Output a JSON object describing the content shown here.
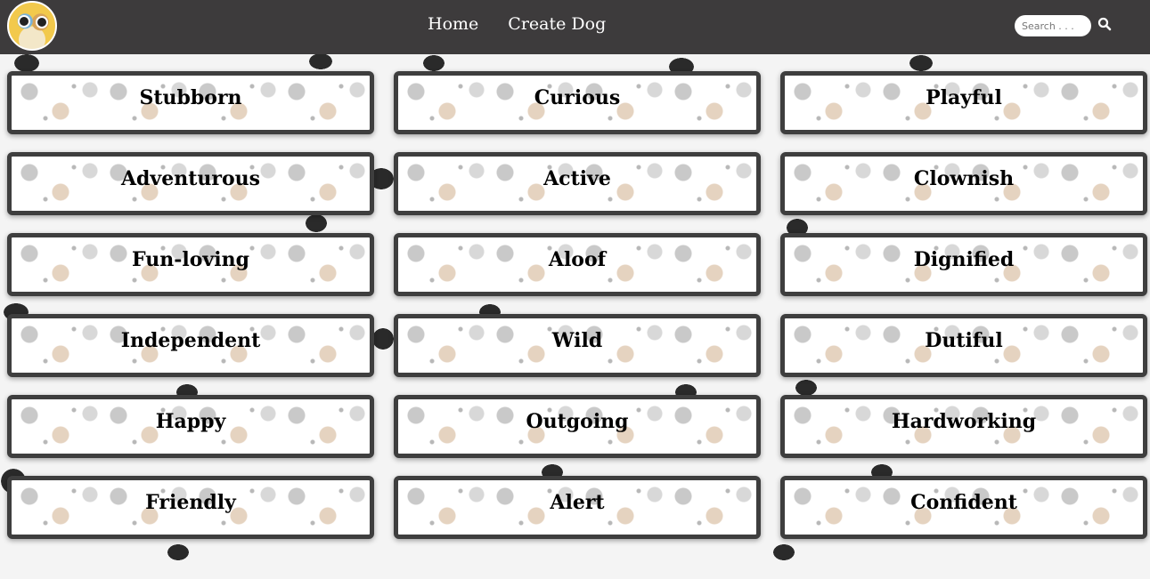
{
  "navbar": {
    "logo_icon": "dog-logo-icon",
    "links": [
      {
        "label": "Home"
      },
      {
        "label": "Create Dog"
      }
    ],
    "search": {
      "placeholder": "Search . . .",
      "value": "",
      "icon": "search-icon"
    }
  },
  "temperaments": [
    {
      "label": "Stubborn"
    },
    {
      "label": "Curious"
    },
    {
      "label": "Playful"
    },
    {
      "label": "Adventurous"
    },
    {
      "label": "Active"
    },
    {
      "label": "Clownish"
    },
    {
      "label": "Fun-loving"
    },
    {
      "label": "Aloof"
    },
    {
      "label": "Dignified"
    },
    {
      "label": "Independent"
    },
    {
      "label": "Wild"
    },
    {
      "label": "Dutiful"
    },
    {
      "label": "Happy"
    },
    {
      "label": "Outgoing"
    },
    {
      "label": "Hardworking"
    },
    {
      "label": "Friendly"
    },
    {
      "label": "Alert"
    },
    {
      "label": "Confident"
    }
  ],
  "colors": {
    "navbar": "#3d3b3c",
    "card_border": "#3e3e3e",
    "paw_print": "#2a2a2a"
  }
}
